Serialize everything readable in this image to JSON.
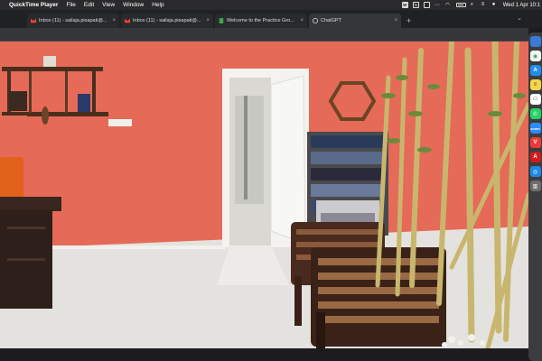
{
  "menubar": {
    "app_name": "QuickTime Player",
    "menus": [
      "File",
      "Edit",
      "View",
      "Window",
      "Help"
    ],
    "clock": "Wed 1 Apr 10:1",
    "status_icons": [
      "wifi-icon",
      "battery-icon",
      "search-icon",
      "control-center-icon",
      "siri-icon"
    ]
  },
  "browser": {
    "tabs": [
      {
        "title": "Inbox (11) - sailaja.pisapati@...",
        "icon": "gmail-icon"
      },
      {
        "title": "Inbox (11) - sailaja.pisapati@...",
        "icon": "gmail-icon"
      },
      {
        "title": "Welcome to the Practice Gro...",
        "icon": "sheets-icon"
      },
      {
        "title": "ChatGPT",
        "icon": "chatgpt-icon",
        "active": true
      }
    ],
    "new_tab_label": "+"
  },
  "video": {
    "scene": "office-room",
    "colors": {
      "wall": "#e66a58",
      "floor": "#e4e2de",
      "door": "#f5f5f5",
      "bamboo": "#c9b66e"
    }
  },
  "dock": {
    "apps": [
      "finder-icon",
      "chrome-icon",
      "app-store-icon",
      "notes-icon",
      "calendar-icon",
      "whatsapp-icon",
      "zoom-icon",
      "vivaldi-icon",
      "acrobat-icon",
      "safari-icon",
      "trash-icon"
    ]
  }
}
